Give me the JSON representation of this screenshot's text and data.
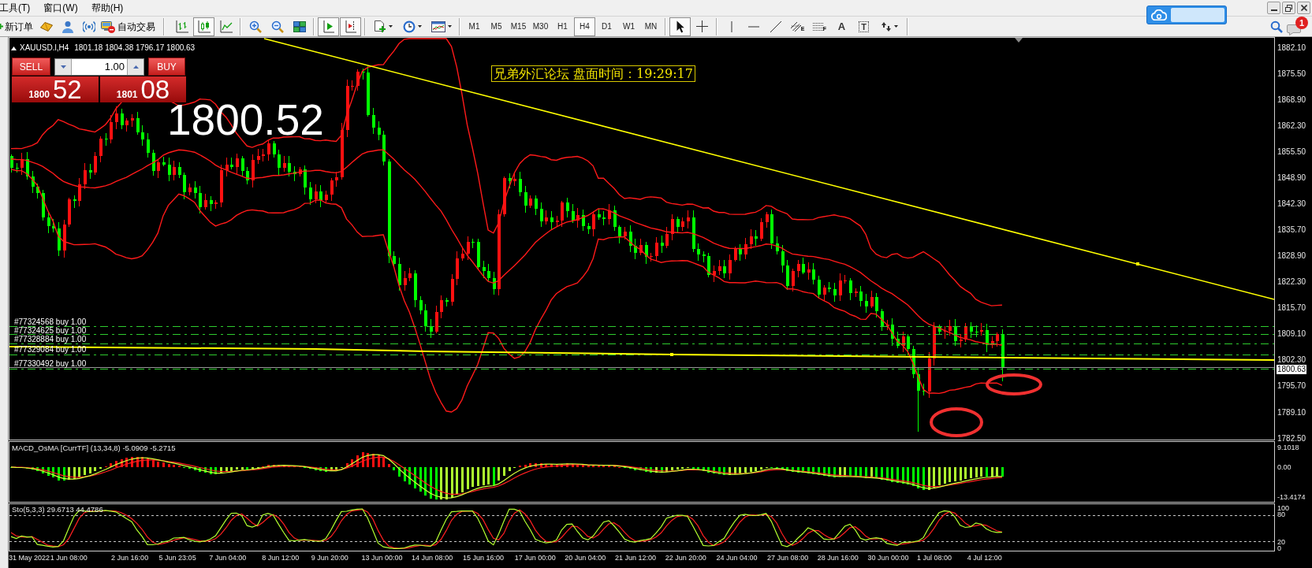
{
  "menu": [
    {
      "label": "工具(T)"
    },
    {
      "label": "窗口(W)"
    },
    {
      "label": "帮助(H)"
    }
  ],
  "toolbar": {
    "new_order": "新订单",
    "auto_trading": "自动交易",
    "chart_types": [
      {
        "kind": "bars",
        "selected": false
      },
      {
        "kind": "candles",
        "selected": true
      },
      {
        "kind": "line",
        "selected": false
      }
    ],
    "scroll_modes": [
      {
        "kind": "auto-scroll",
        "selected": true
      },
      {
        "kind": "chart-shift",
        "selected": true
      }
    ],
    "timeframes": [
      {
        "label": "M1",
        "selected": false
      },
      {
        "label": "M5",
        "selected": false
      },
      {
        "label": "M15",
        "selected": false
      },
      {
        "label": "M30",
        "selected": false
      },
      {
        "label": "H1",
        "selected": false
      },
      {
        "label": "H4",
        "selected": true
      },
      {
        "label": "D1",
        "selected": false
      },
      {
        "label": "W1",
        "selected": false
      },
      {
        "label": "MN",
        "selected": false
      }
    ],
    "drawing_tools": [
      {
        "kind": "cursor",
        "selected": true
      },
      {
        "kind": "crosshair",
        "selected": false
      },
      {
        "kind": "vertical-line",
        "selected": false
      },
      {
        "kind": "horizontal-line",
        "selected": false
      },
      {
        "kind": "trend-line",
        "selected": false
      },
      {
        "kind": "channel",
        "glyph": "E",
        "selected": false
      },
      {
        "kind": "fibonacci",
        "glyph": "F",
        "selected": false
      },
      {
        "kind": "text",
        "glyph": "A",
        "selected": false
      },
      {
        "kind": "label",
        "glyph": "T",
        "selected": false
      },
      {
        "kind": "arrows",
        "selected": false
      }
    ],
    "notifications": "1"
  },
  "chart": {
    "symbol": "XAUUSD.l,H4",
    "ohlc": "1801.18 1804.38 1796.17 1800.63",
    "one_click": {
      "sell": "SELL",
      "buy": "BUY",
      "lot": "1.00",
      "bid_big": "1800",
      "bid_pips": "52",
      "ask_big": "1801",
      "ask_pips": "08"
    },
    "bid_display": "1800.52",
    "info_label": "兄弟外汇论坛 盘面时间：19:29:17",
    "orders": [
      {
        "label": "#77324568 buy 1.00"
      },
      {
        "label": "#77324625 buy 1.00"
      },
      {
        "label": "#77328884 buy 1.00"
      },
      {
        "label": "#77329084 buy 1.00"
      },
      {
        "label": "#77330492 buy 1.00"
      }
    ],
    "price_axis": [
      "1882.10",
      "1875.50",
      "1868.90",
      "1862.30",
      "1855.50",
      "1848.90",
      "1842.30",
      "1835.70",
      "1828.90",
      "1822.30",
      "1815.70",
      "1809.10",
      "1802.30",
      "1795.70",
      "1789.10",
      "1782.50"
    ],
    "current_price": "1800.63"
  },
  "macd": {
    "label": "MACD_OsMA [CurrTF] (13,34,8) -5.0909 -5.2715",
    "axis": [
      "9.1018",
      "0.00",
      "-13.4174"
    ]
  },
  "stochastic": {
    "label": "Sto(5,3,3) 29.6713 44.4786",
    "axis": [
      "100",
      "80",
      "20",
      "0"
    ]
  },
  "time_axis": [
    "31 May 2022",
    "1 Jun 08:00",
    "2 Jun 16:00",
    "5 Jun 23:05",
    "7 Jun 04:00",
    "8 Jun 12:00",
    "9 Jun 20:00",
    "13 Jun 00:00",
    "14 Jun 08:00",
    "15 Jun 16:00",
    "17 Jun 00:00",
    "20 Jun 04:00",
    "21 Jun 12:00",
    "22 Jun 20:00",
    "24 Jun 04:00",
    "27 Jun 08:00",
    "28 Jun 16:00",
    "30 Jun 00:00",
    "1 Jul 08:00",
    "4 Jul 12:00"
  ]
}
